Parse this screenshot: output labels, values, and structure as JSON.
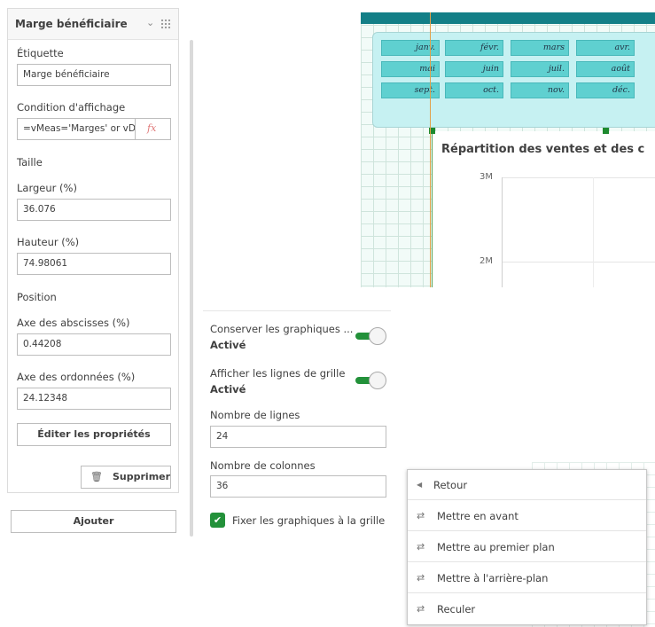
{
  "panel": {
    "title": "Marge bénéficiaire",
    "label_label": "Étiquette",
    "label_value": "Marge bénéficiaire",
    "condition_label": "Condition d'affichage",
    "condition_value": "=vMeas='Marges' or vDe'",
    "fx": "fx",
    "size_section": "Taille",
    "width_label": "Largeur (%)",
    "width_value": "36.076",
    "height_label": "Hauteur (%)",
    "height_value": "74.98061",
    "position_section": "Position",
    "x_label": "Axe des abscisses (%)",
    "x_value": "0.44208",
    "y_label": "Axe des ordonnées (%)",
    "y_value": "24.12348",
    "edit_button": "Éditer les propriétés",
    "delete_button": "Supprimer",
    "add_button": "Ajouter"
  },
  "canvas": {
    "months": [
      "janv.",
      "févr.",
      "mars",
      "avr.",
      "mai",
      "juin",
      "juil.",
      "août",
      "sept.",
      "oct.",
      "nov.",
      "déc."
    ],
    "chart_title": "Répartition des ventes et des c",
    "ticks": [
      "3M",
      "2M"
    ]
  },
  "grid_settings": {
    "keep_charts_label": "Conserver les graphiques ...",
    "keep_charts_state": "Activé",
    "show_grid_label": "Afficher les lignes de grille",
    "show_grid_state": "Activé",
    "rows_label": "Nombre de lignes",
    "rows_value": "24",
    "cols_label": "Nombre de colonnes",
    "cols_value": "36",
    "snap_label": "Fixer les graphiques à la grille"
  },
  "menu": {
    "back": "Retour",
    "items": [
      "Mettre en avant",
      "Mettre au premier plan",
      "Mettre à l'arrière-plan",
      "Reculer"
    ]
  },
  "colors": {
    "accent_green": "#23913a",
    "teal_bar": "#137f87",
    "month_cell": "#5fd0d0"
  }
}
